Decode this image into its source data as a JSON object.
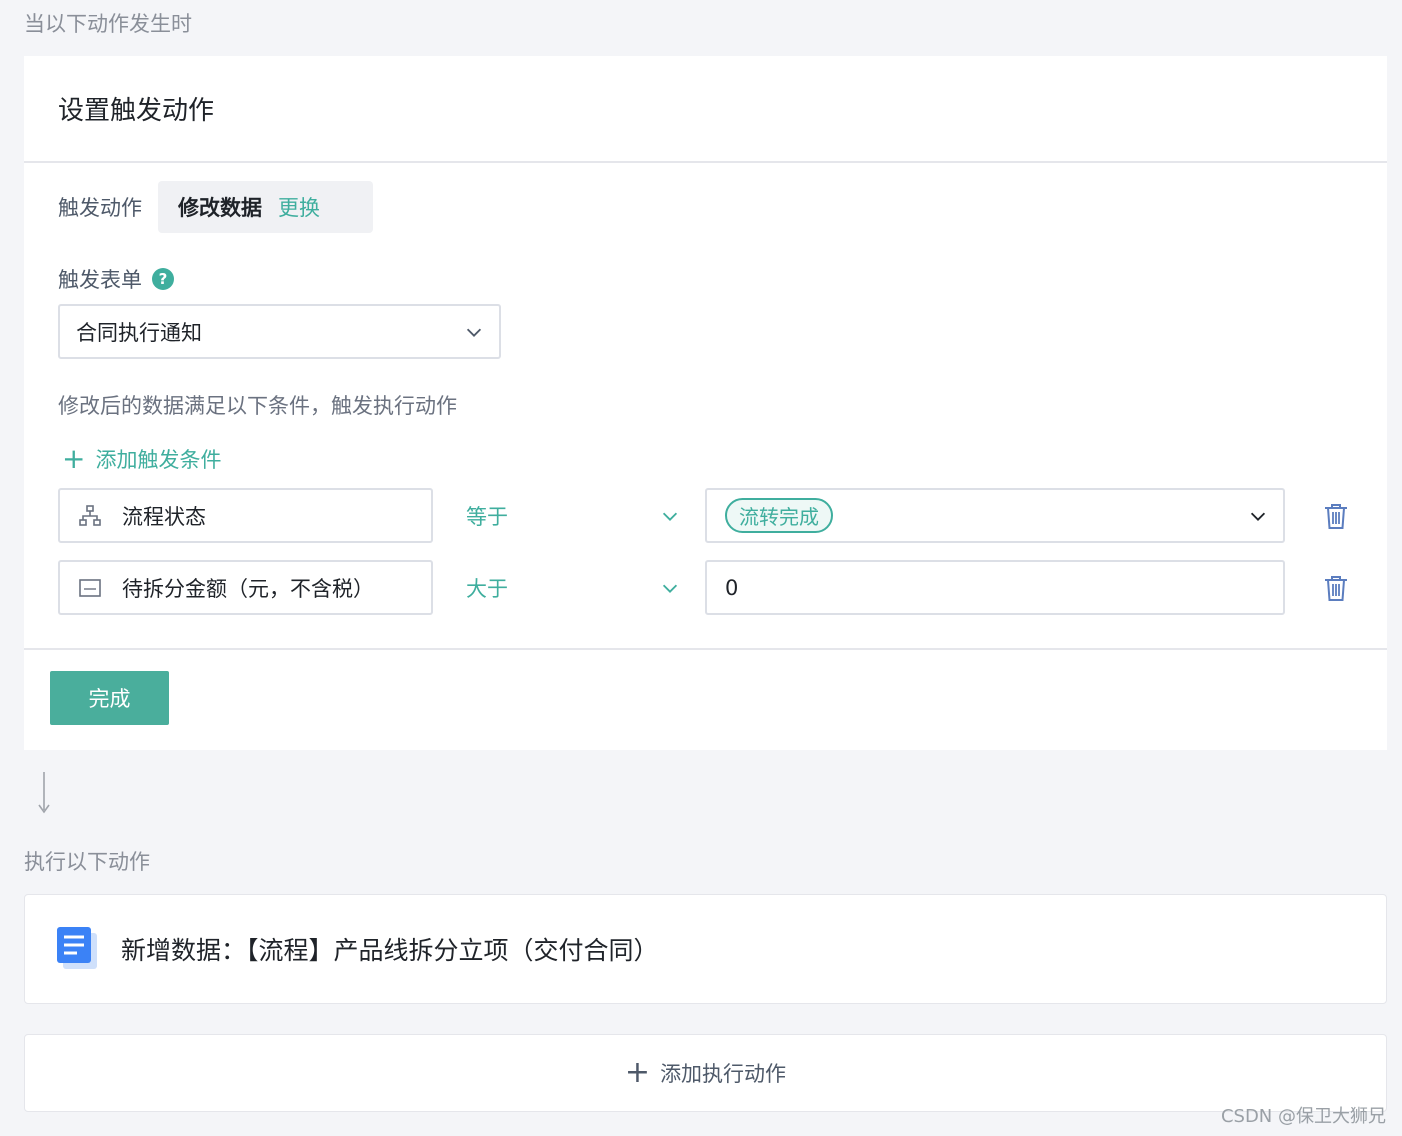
{
  "trigger_section": {
    "label": "当以下动作发生时",
    "card_title": "设置触发动作",
    "action_label": "触发动作",
    "action_value": "修改数据",
    "action_switch": "更换",
    "form_label": "触发表单",
    "form_help_icon": "help-icon",
    "form_value": "合同执行通知",
    "condition_desc": "修改后的数据满足以下条件，触发执行动作",
    "add_condition": "添加触发条件",
    "conditions": [
      {
        "field_icon": "org-tree-icon",
        "field": "流程状态",
        "operator": "等于",
        "value_tag": "流转完成"
      },
      {
        "field_icon": "number-field-icon",
        "field": "待拆分金额（元，不含税）",
        "operator": "大于",
        "value": "0"
      }
    ],
    "done_button": "完成"
  },
  "exec_section": {
    "label": "执行以下动作",
    "action_icon": "document-icon",
    "action_text": "新增数据：【流程】产品线拆分立项（交付合同）",
    "add_action": "添加执行动作"
  },
  "watermark": "CSDN @保卫大狮兄",
  "colors": {
    "accent": "#3fae9e",
    "button": "#4aae9c",
    "doc_icon": "#3b82f6",
    "trash_icon": "#5b7dbf"
  }
}
